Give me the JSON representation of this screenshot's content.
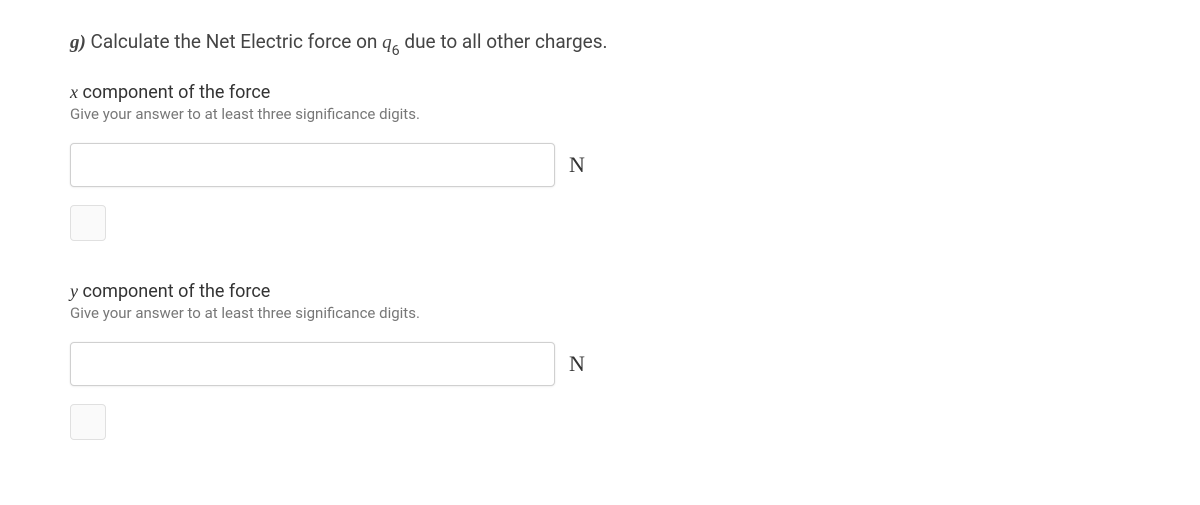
{
  "question": {
    "label": "g)",
    "text_before": " Calculate the Net Electric force on ",
    "variable": "q",
    "subscript": "6",
    "text_after": " due to all other charges."
  },
  "components": [
    {
      "var": "x",
      "title_rest": " component of the force",
      "hint": "Give your answer to at least three significance digits.",
      "unit": "N",
      "value": ""
    },
    {
      "var": "y",
      "title_rest": " component of the force",
      "hint": "Give your answer to at least three significance digits.",
      "unit": "N",
      "value": ""
    }
  ]
}
